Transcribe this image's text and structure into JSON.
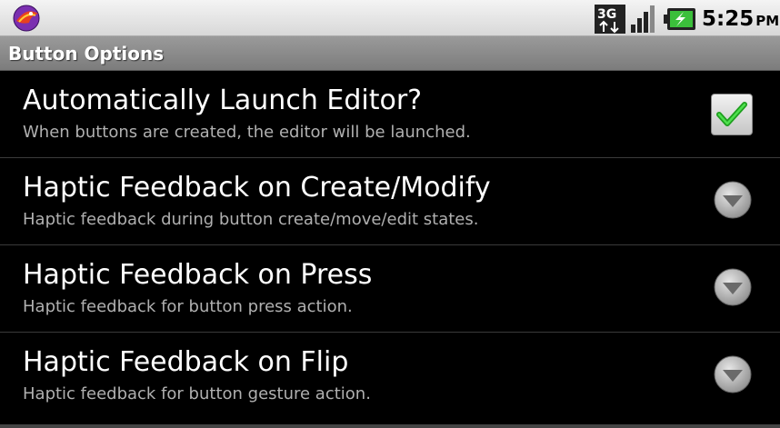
{
  "status_bar": {
    "time": "5:25",
    "ampm": "PM",
    "network_label": "3G",
    "icons": [
      "app-icon",
      "3g-network-icon",
      "signal-strength-icon",
      "battery-charging-icon"
    ]
  },
  "title_bar": {
    "title": "Button Options"
  },
  "preferences": [
    {
      "title": "Automatically Launch Editor?",
      "summary": "When buttons are created, the editor will be launched.",
      "control": "checkbox",
      "checked": true
    },
    {
      "title": "Haptic Feedback on Create/Modify",
      "summary": "Haptic feedback during button create/move/edit states.",
      "control": "dropdown"
    },
    {
      "title": "Haptic Feedback on Press",
      "summary": "Haptic feedback for button press action.",
      "control": "dropdown"
    },
    {
      "title": "Haptic Feedback on Flip",
      "summary": "Haptic feedback for button gesture action.",
      "control": "dropdown"
    }
  ],
  "colors": {
    "background": "#000000",
    "title_bar": "#8a8a8a",
    "summary_text": "#b0b0b0",
    "check_green": "#2db82d"
  }
}
